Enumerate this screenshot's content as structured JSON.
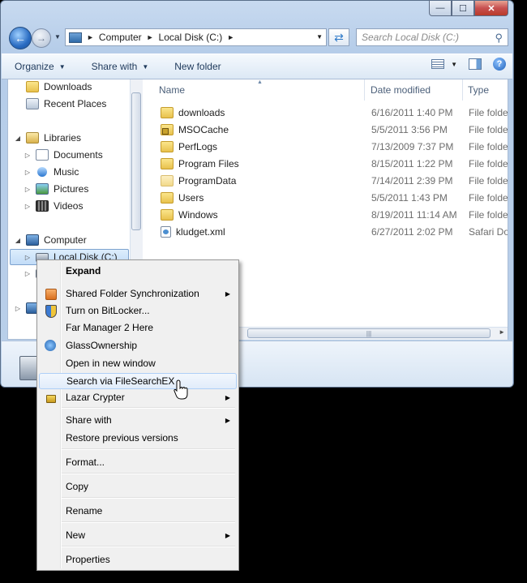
{
  "window": {
    "minimize_glyph": "—",
    "maximize_glyph": "☐",
    "close_glyph": "✕"
  },
  "address": {
    "crumbs": [
      "Computer",
      "Local Disk (C:)"
    ],
    "search_placeholder": "Search Local Disk (C:)"
  },
  "toolbar": {
    "organize": "Organize",
    "share_with": "Share with",
    "new_folder": "New folder"
  },
  "nav": {
    "downloads": "Downloads",
    "recent_places": "Recent Places",
    "libraries": "Libraries",
    "documents": "Documents",
    "music": "Music",
    "pictures": "Pictures",
    "videos": "Videos",
    "computer": "Computer",
    "local_disk": "Local Disk (C:)"
  },
  "columns": {
    "name": "Name",
    "date_modified": "Date modified",
    "type": "Type"
  },
  "files": [
    {
      "name": "downloads",
      "date": "6/16/2011 1:40 PM",
      "type": "File folder",
      "icon": "folder-icon"
    },
    {
      "name": "MSOCache",
      "date": "5/5/2011 3:56 PM",
      "type": "File folder",
      "icon": "locked-folder-icon"
    },
    {
      "name": "PerfLogs",
      "date": "7/13/2009 7:37 PM",
      "type": "File folder",
      "icon": "folder-icon"
    },
    {
      "name": "Program Files",
      "date": "8/15/2011 1:22 PM",
      "type": "File folder",
      "icon": "folder-icon"
    },
    {
      "name": "ProgramData",
      "date": "7/14/2011 2:39 PM",
      "type": "File folder",
      "icon": "hidden-folder-icon"
    },
    {
      "name": "Users",
      "date": "5/5/2011 1:43 PM",
      "type": "File folder",
      "icon": "folder-icon"
    },
    {
      "name": "Windows",
      "date": "8/19/2011 11:14 AM",
      "type": "File folder",
      "icon": "folder-icon"
    },
    {
      "name": "kludget.xml",
      "date": "6/27/2011 2:02 PM",
      "type": "Safari Document",
      "icon": "xml-file-icon"
    }
  ],
  "context_menu": {
    "expand": "Expand",
    "shared_folder_sync": "Shared Folder Synchronization",
    "bitlocker": "Turn on BitLocker...",
    "far_manager": "Far Manager 2 Here",
    "glass_ownership": "GlassOwnership",
    "open_new_window": "Open in new window",
    "search_filesearchex": "Search via FileSearchEX",
    "lazar_crypter": "Lazar Crypter",
    "share_with": "Share with",
    "restore_previous": "Restore previous versions",
    "format": "Format...",
    "copy": "Copy",
    "rename": "Rename",
    "new": "New",
    "properties": "Properties"
  },
  "colors": {
    "menu_hover": "#e1ecfa",
    "selection": "#c2dcf7"
  }
}
